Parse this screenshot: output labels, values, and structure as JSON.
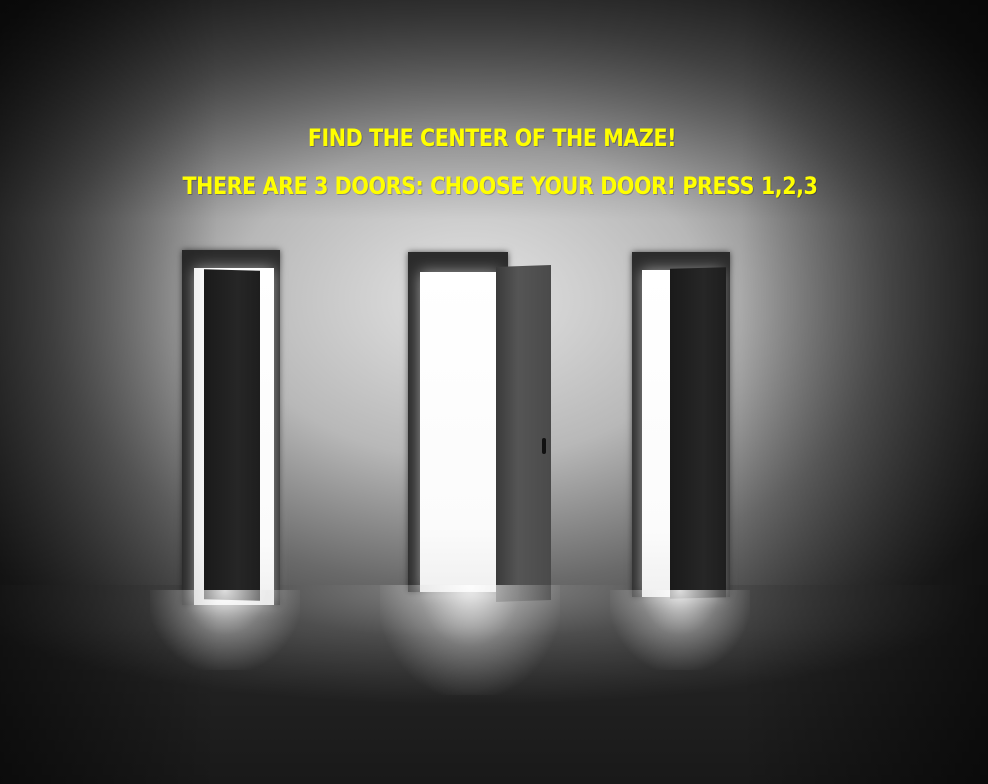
{
  "game": {
    "title_line": "FIND THE CENTER OF THE MAZE!",
    "instruction_line": "THERE ARE 3 DOORS: CHOOSE YOUR DOOR! PRESS 1,2,3",
    "text_color": "#ffff00"
  },
  "doors": [
    {
      "key": "1",
      "state": "ajar"
    },
    {
      "key": "2",
      "state": "open"
    },
    {
      "key": "3",
      "state": "ajar"
    }
  ]
}
